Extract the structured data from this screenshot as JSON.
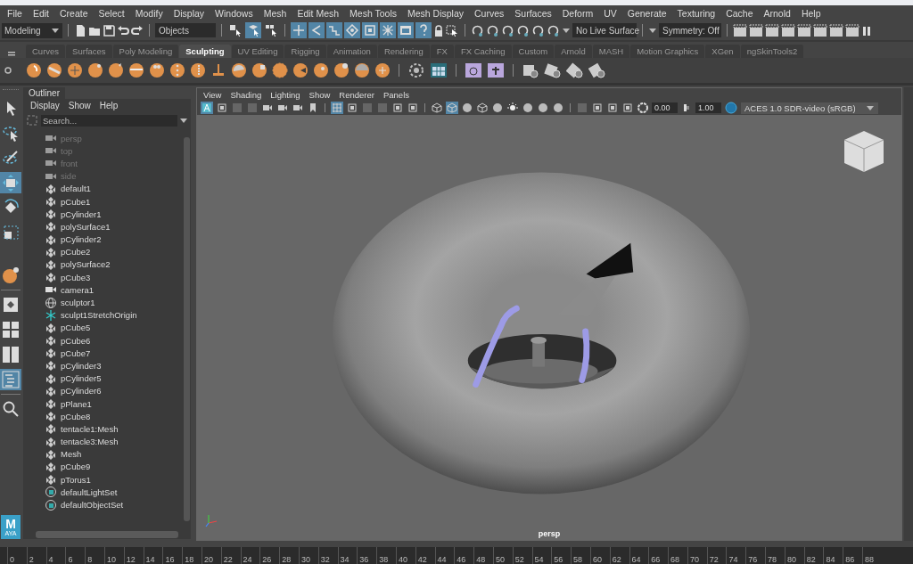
{
  "menu_bar": [
    "File",
    "Edit",
    "Create",
    "Select",
    "Modify",
    "Display",
    "Windows",
    "Mesh",
    "Edit Mesh",
    "Mesh Tools",
    "Mesh Display",
    "Curves",
    "Surfaces",
    "Deform",
    "UV",
    "Generate",
    "Texturing",
    "Cache",
    "Arnold",
    "Help"
  ],
  "status_line": {
    "menu_set": "Modeling",
    "selection_mode": "Objects",
    "live_surface": "No Live Surface",
    "symmetry": "Symmetry: Off",
    "select_modes": [
      {
        "kind": "hierarchy",
        "selected": false
      },
      {
        "kind": "object",
        "selected": true
      },
      {
        "kind": "component",
        "selected": false
      }
    ],
    "masks": [
      {
        "kind": "plus",
        "on": true
      },
      {
        "kind": "curve",
        "on": true
      },
      {
        "kind": "wave",
        "on": true
      },
      {
        "kind": "diamond",
        "on": true
      },
      {
        "kind": "frame",
        "on": true
      },
      {
        "kind": "star",
        "on": true
      },
      {
        "kind": "film",
        "on": true
      },
      {
        "kind": "question",
        "on": true
      }
    ]
  },
  "shelf": {
    "tabs": [
      {
        "label": "Curves",
        "selected": false
      },
      {
        "label": "Surfaces",
        "selected": false
      },
      {
        "label": "Poly Modeling",
        "selected": false
      },
      {
        "label": "Sculpting",
        "selected": true
      },
      {
        "label": "UV Editing",
        "selected": false
      },
      {
        "label": "Rigging",
        "selected": false
      },
      {
        "label": "Animation",
        "selected": false
      },
      {
        "label": "Rendering",
        "selected": false
      },
      {
        "label": "FX",
        "selected": false
      },
      {
        "label": "FX Caching",
        "selected": false
      },
      {
        "label": "Custom",
        "selected": false
      },
      {
        "label": "Arnold",
        "selected": false
      },
      {
        "label": "MASH",
        "selected": false
      },
      {
        "label": "Motion Graphics",
        "selected": false
      },
      {
        "label": "XGen",
        "selected": false
      },
      {
        "label": "ngSkinTools2",
        "selected": false
      }
    ]
  },
  "toolbox": {
    "tools": [
      {
        "kind": "select",
        "selected": false
      },
      {
        "kind": "lasso",
        "selected": false
      },
      {
        "kind": "paint",
        "selected": false
      },
      {
        "kind": "move",
        "selected": true
      },
      {
        "kind": "rotate",
        "selected": false
      },
      {
        "kind": "scale",
        "selected": false
      }
    ],
    "layouts": [
      {
        "kind": "single",
        "selected": false
      },
      {
        "kind": "four",
        "selected": false
      },
      {
        "kind": "two",
        "selected": false
      },
      {
        "kind": "outliner",
        "selected": true
      }
    ],
    "logo": {
      "letter": "M",
      "caption": "AYA"
    }
  },
  "outliner": {
    "title": "Outliner",
    "menus": [
      "Display",
      "Show",
      "Help"
    ],
    "search": {
      "placeholder": "Search..."
    },
    "items": [
      {
        "label": "persp",
        "kind": "camera",
        "dimmed": true
      },
      {
        "label": "top",
        "kind": "camera",
        "dimmed": true
      },
      {
        "label": "front",
        "kind": "camera",
        "dimmed": true
      },
      {
        "label": "side",
        "kind": "camera",
        "dimmed": true
      },
      {
        "label": "default1",
        "kind": "mesh",
        "dimmed": false
      },
      {
        "label": "pCube1",
        "kind": "mesh",
        "dimmed": false
      },
      {
        "label": "pCylinder1",
        "kind": "mesh",
        "dimmed": false
      },
      {
        "label": "polySurface1",
        "kind": "mesh",
        "dimmed": false
      },
      {
        "label": "pCylinder2",
        "kind": "mesh",
        "dimmed": false
      },
      {
        "label": "pCube2",
        "kind": "mesh",
        "dimmed": false
      },
      {
        "label": "polySurface2",
        "kind": "mesh",
        "dimmed": false
      },
      {
        "label": "pCube3",
        "kind": "mesh",
        "dimmed": false
      },
      {
        "label": "camera1",
        "kind": "camera",
        "dimmed": false
      },
      {
        "label": "sculptor1",
        "kind": "sculptor",
        "dimmed": false
      },
      {
        "label": "sculpt1StretchOrigin",
        "kind": "locator",
        "dimmed": false
      },
      {
        "label": "pCube5",
        "kind": "mesh",
        "dimmed": false
      },
      {
        "label": "pCube6",
        "kind": "mesh",
        "dimmed": false
      },
      {
        "label": "pCube7",
        "kind": "mesh",
        "dimmed": false
      },
      {
        "label": "pCylinder3",
        "kind": "mesh",
        "dimmed": false
      },
      {
        "label": "pCylinder5",
        "kind": "mesh",
        "dimmed": false
      },
      {
        "label": "pCylinder6",
        "kind": "mesh",
        "dimmed": false
      },
      {
        "label": "pPlane1",
        "kind": "mesh",
        "dimmed": false
      },
      {
        "label": "pCube8",
        "kind": "mesh",
        "dimmed": false
      },
      {
        "label": "tentacle1:Mesh",
        "kind": "mesh",
        "dimmed": false
      },
      {
        "label": "tentacle3:Mesh",
        "kind": "mesh",
        "dimmed": false
      },
      {
        "label": "Mesh",
        "kind": "mesh",
        "dimmed": false
      },
      {
        "label": "pCube9",
        "kind": "mesh",
        "dimmed": false
      },
      {
        "label": "pTorus1",
        "kind": "mesh",
        "dimmed": false
      },
      {
        "label": "defaultLightSet",
        "kind": "set",
        "dimmed": false
      },
      {
        "label": "defaultObjectSet",
        "kind": "set",
        "dimmed": false
      }
    ]
  },
  "viewport": {
    "menus": [
      "View",
      "Shading",
      "Lighting",
      "Show",
      "Renderer",
      "Panels"
    ],
    "toolbar": [
      {
        "kind": "letter",
        "on": true
      },
      {
        "kind": "frame",
        "on": false
      },
      {
        "kind": "square",
        "on": false
      },
      {
        "kind": "square",
        "on": false
      },
      {
        "kind": "camera",
        "on": false
      },
      {
        "kind": "camera",
        "on": false
      },
      {
        "kind": "camera",
        "on": false
      },
      {
        "kind": "bookmark",
        "on": false
      },
      {
        "kind": "grid",
        "on": true
      },
      {
        "kind": "frame",
        "on": false
      },
      {
        "kind": "square",
        "on": false
      },
      {
        "kind": "square",
        "on": false
      },
      {
        "kind": "frame",
        "on": false
      },
      {
        "kind": "frame",
        "on": false
      },
      {
        "kind": "cube",
        "on": false
      },
      {
        "kind": "cube",
        "on": true
      },
      {
        "kind": "sphere",
        "on": false
      },
      {
        "kind": "cube",
        "on": false
      },
      {
        "kind": "sphere",
        "on": false
      },
      {
        "kind": "light",
        "on": false
      },
      {
        "kind": "sphere",
        "on": false
      },
      {
        "kind": "sphere",
        "on": false
      },
      {
        "kind": "sphere",
        "on": false
      },
      {
        "kind": "square",
        "on": false
      },
      {
        "kind": "frame",
        "on": false
      },
      {
        "kind": "frame",
        "on": false
      },
      {
        "kind": "frame",
        "on": false
      }
    ],
    "exposure": "0.00",
    "gamma": "1.00",
    "color_space": "ACES 1.0 SDR-video (sRGB)",
    "camera_label": "persp"
  },
  "timeline": {
    "frames": [
      "0",
      "2",
      "4",
      "6",
      "8",
      "10",
      "12",
      "14",
      "16",
      "18",
      "20",
      "22",
      "24",
      "26",
      "28",
      "30",
      "32",
      "34",
      "36",
      "38",
      "40",
      "42",
      "44",
      "46",
      "48",
      "50",
      "52",
      "54",
      "56",
      "58",
      "60",
      "62",
      "64",
      "66",
      "68",
      "70",
      "72",
      "74",
      "76",
      "78",
      "80",
      "82",
      "84",
      "86",
      "88"
    ]
  }
}
